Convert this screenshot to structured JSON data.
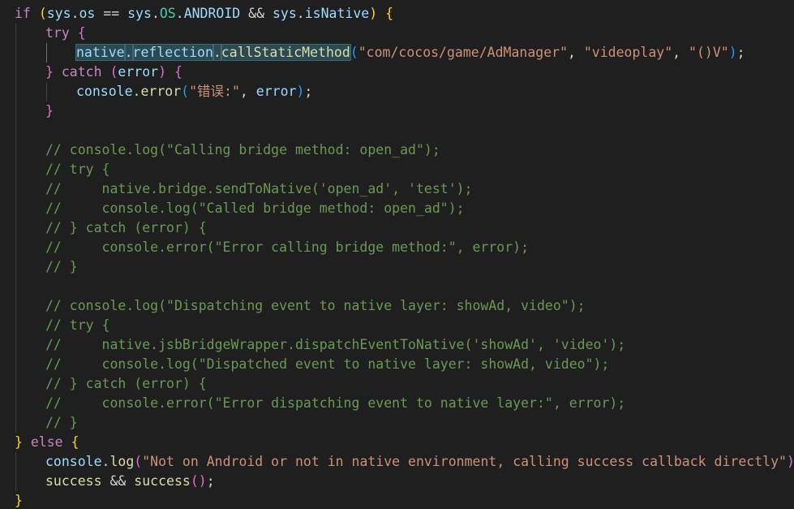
{
  "editor": {
    "language": "javascript",
    "lines": [
      {
        "indent": 0,
        "tokens": [
          {
            "t": "if",
            "c": "kw"
          },
          {
            "t": " ",
            "c": "pl"
          },
          {
            "t": "(",
            "c": "br1"
          },
          {
            "t": "sys",
            "c": "var"
          },
          {
            "t": ".",
            "c": "pl"
          },
          {
            "t": "os",
            "c": "var"
          },
          {
            "t": " == ",
            "c": "pl"
          },
          {
            "t": "sys",
            "c": "var"
          },
          {
            "t": ".",
            "c": "pl"
          },
          {
            "t": "OS",
            "c": "cls"
          },
          {
            "t": ".",
            "c": "pl"
          },
          {
            "t": "ANDROID",
            "c": "var"
          },
          {
            "t": " && ",
            "c": "pl"
          },
          {
            "t": "sys",
            "c": "var"
          },
          {
            "t": ".",
            "c": "pl"
          },
          {
            "t": "isNative",
            "c": "var"
          },
          {
            "t": ")",
            "c": "br1"
          },
          {
            "t": " ",
            "c": "pl"
          },
          {
            "t": "{",
            "c": "br1"
          }
        ]
      },
      {
        "indent": 1,
        "tokens": [
          {
            "t": "try",
            "c": "kw"
          },
          {
            "t": " ",
            "c": "pl"
          },
          {
            "t": "{",
            "c": "br2"
          }
        ]
      },
      {
        "indent": 2,
        "tokens": [
          {
            "t": "native",
            "c": "var hl"
          },
          {
            "t": ".",
            "c": "pl hl"
          },
          {
            "t": "reflection",
            "c": "var hl"
          },
          {
            "t": ".",
            "c": "pl hl"
          },
          {
            "t": "callStaticMethod",
            "c": "fn hl"
          },
          {
            "t": "(",
            "c": "br3"
          },
          {
            "t": "\"com/cocos/game/AdManager\"",
            "c": "str"
          },
          {
            "t": ", ",
            "c": "pl"
          },
          {
            "t": "\"videoplay\"",
            "c": "str"
          },
          {
            "t": ", ",
            "c": "pl"
          },
          {
            "t": "\"()V\"",
            "c": "str"
          },
          {
            "t": ")",
            "c": "br3"
          },
          {
            "t": ";",
            "c": "pl"
          }
        ]
      },
      {
        "indent": 1,
        "tokens": [
          {
            "t": "}",
            "c": "br2"
          },
          {
            "t": " ",
            "c": "pl"
          },
          {
            "t": "catch",
            "c": "kw"
          },
          {
            "t": " ",
            "c": "pl"
          },
          {
            "t": "(",
            "c": "br2"
          },
          {
            "t": "error",
            "c": "var"
          },
          {
            "t": ")",
            "c": "br2"
          },
          {
            "t": " ",
            "c": "pl"
          },
          {
            "t": "{",
            "c": "br2"
          }
        ]
      },
      {
        "indent": 2,
        "tokens": [
          {
            "t": "console",
            "c": "var"
          },
          {
            "t": ".",
            "c": "pl"
          },
          {
            "t": "error",
            "c": "fn"
          },
          {
            "t": "(",
            "c": "br3"
          },
          {
            "t": "\"错误:\"",
            "c": "str"
          },
          {
            "t": ", ",
            "c": "pl"
          },
          {
            "t": "error",
            "c": "var"
          },
          {
            "t": ")",
            "c": "br3"
          },
          {
            "t": ";",
            "c": "pl"
          }
        ]
      },
      {
        "indent": 1,
        "tokens": [
          {
            "t": "}",
            "c": "br2"
          }
        ]
      },
      {
        "indent": 0,
        "tokens": []
      },
      {
        "indent": 1,
        "tokens": [
          {
            "t": "// console.log(\"Calling bridge method: open_ad\");",
            "c": "cm"
          }
        ]
      },
      {
        "indent": 1,
        "tokens": [
          {
            "t": "// try {",
            "c": "cm"
          }
        ]
      },
      {
        "indent": 1,
        "tokens": [
          {
            "t": "//     native.bridge.sendToNative('open_ad', 'test');",
            "c": "cm"
          }
        ]
      },
      {
        "indent": 1,
        "tokens": [
          {
            "t": "//     console.log(\"Called bridge method: open_ad\");",
            "c": "cm"
          }
        ]
      },
      {
        "indent": 1,
        "tokens": [
          {
            "t": "// } catch (error) {",
            "c": "cm"
          }
        ]
      },
      {
        "indent": 1,
        "tokens": [
          {
            "t": "//     console.error(\"Error calling bridge method:\", error);",
            "c": "cm"
          }
        ]
      },
      {
        "indent": 1,
        "tokens": [
          {
            "t": "// }",
            "c": "cm"
          }
        ]
      },
      {
        "indent": 0,
        "tokens": []
      },
      {
        "indent": 1,
        "tokens": [
          {
            "t": "// console.log(\"Dispatching event to native layer: showAd, video\");",
            "c": "cm"
          }
        ]
      },
      {
        "indent": 1,
        "tokens": [
          {
            "t": "// try {",
            "c": "cm"
          }
        ]
      },
      {
        "indent": 1,
        "tokens": [
          {
            "t": "//     native.jsbBridgeWrapper.dispatchEventToNative('showAd', 'video');",
            "c": "cm"
          }
        ]
      },
      {
        "indent": 1,
        "tokens": [
          {
            "t": "//     console.log(\"Dispatched event to native layer: showAd, video\");",
            "c": "cm"
          }
        ]
      },
      {
        "indent": 1,
        "tokens": [
          {
            "t": "// } catch (error) {",
            "c": "cm"
          }
        ]
      },
      {
        "indent": 1,
        "tokens": [
          {
            "t": "//     console.error(\"Error dispatching event to native layer:\", error);",
            "c": "cm"
          }
        ]
      },
      {
        "indent": 1,
        "tokens": [
          {
            "t": "// }",
            "c": "cm"
          }
        ]
      },
      {
        "indent": 0,
        "tokens": [
          {
            "t": "}",
            "c": "br1"
          },
          {
            "t": " ",
            "c": "pl"
          },
          {
            "t": "else",
            "c": "kw"
          },
          {
            "t": " ",
            "c": "pl"
          },
          {
            "t": "{",
            "c": "br1"
          }
        ]
      },
      {
        "indent": 1,
        "tokens": [
          {
            "t": "console",
            "c": "var"
          },
          {
            "t": ".",
            "c": "pl"
          },
          {
            "t": "log",
            "c": "fn"
          },
          {
            "t": "(",
            "c": "br2"
          },
          {
            "t": "\"Not on Android or not in native environment, calling success callback directly\"",
            "c": "str"
          },
          {
            "t": ")",
            "c": "br2"
          },
          {
            "t": ";",
            "c": "pl"
          }
        ]
      },
      {
        "indent": 1,
        "tokens": [
          {
            "t": "success",
            "c": "fn"
          },
          {
            "t": " && ",
            "c": "pl"
          },
          {
            "t": "success",
            "c": "fn"
          },
          {
            "t": "(",
            "c": "br2"
          },
          {
            "t": ")",
            "c": "br2"
          },
          {
            "t": ";",
            "c": "pl"
          }
        ]
      },
      {
        "indent": 0,
        "tokens": [
          {
            "t": "}",
            "c": "br1"
          }
        ]
      }
    ]
  }
}
